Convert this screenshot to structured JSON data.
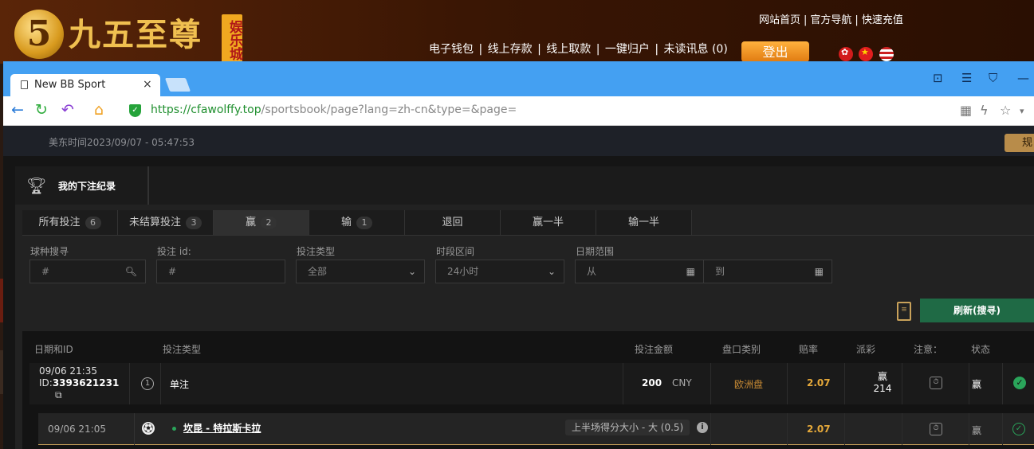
{
  "site": {
    "logo_char": "5",
    "name": "九五至尊",
    "badge": "娱乐城",
    "top_links": [
      "网站首页",
      "|",
      "官方导航",
      "|",
      "快速充值"
    ],
    "account_links": [
      "电子钱包",
      "|",
      "线上存款",
      "|",
      "线上取款",
      "|",
      "一键归户",
      "|",
      "未读讯息 (0)"
    ],
    "logout": "登出"
  },
  "browser": {
    "tab_title": "New BB Sport",
    "tab_close": "×",
    "url_proto": "https://",
    "url_host": "cfawolffy.top",
    "url_path": "/sportsbook/page?lang=zh-cn&type=&page="
  },
  "page": {
    "us_time": "美东时间2023/09/07 - 05:47:53",
    "rules_label": "规",
    "panel_title": "我的下注纪录",
    "tabs": [
      {
        "label": "所有投注",
        "count": "6"
      },
      {
        "label": "未结算投注",
        "count": "3"
      },
      {
        "label": "赢",
        "count": "2"
      },
      {
        "label": "输",
        "count": "1"
      },
      {
        "label": "退回",
        "count": ""
      },
      {
        "label": "赢一半",
        "count": ""
      },
      {
        "label": "输一半",
        "count": ""
      }
    ],
    "filters": {
      "sport_label": "球种搜寻",
      "sport_placeholder": "#",
      "betid_label": "投注 id:",
      "betid_placeholder": "#",
      "bettype_label": "投注类型",
      "bettype_value": "全部",
      "period_label": "时段区间",
      "period_value": "24小时",
      "date_label": "日期范围",
      "date_from": "从",
      "date_to": "到"
    },
    "refresh_label": "刷新(搜寻)",
    "columns": {
      "date_id": "日期和ID",
      "bet_type": "投注类型",
      "amount": "投注金额",
      "market": "盘口类别",
      "odds": "赔率",
      "payout": "派彩",
      "note": "注意：",
      "status": "状态"
    },
    "bet": {
      "date": "09/06 21:35",
      "id_prefix": "ID:",
      "id": "3393621231",
      "num": "1",
      "type": "单注",
      "amount": "200",
      "currency": "CNY",
      "market": "欧洲盘",
      "odds": "2.07",
      "payout_label": "赢",
      "payout_value": "214",
      "status": "赢"
    },
    "leg": {
      "date": "09/06 21:05",
      "match": "坎昆 - 特拉斯卡拉",
      "selection": "上半场得分大小 - 大 (0.5)",
      "odds": "2.07",
      "status": "赢"
    }
  }
}
